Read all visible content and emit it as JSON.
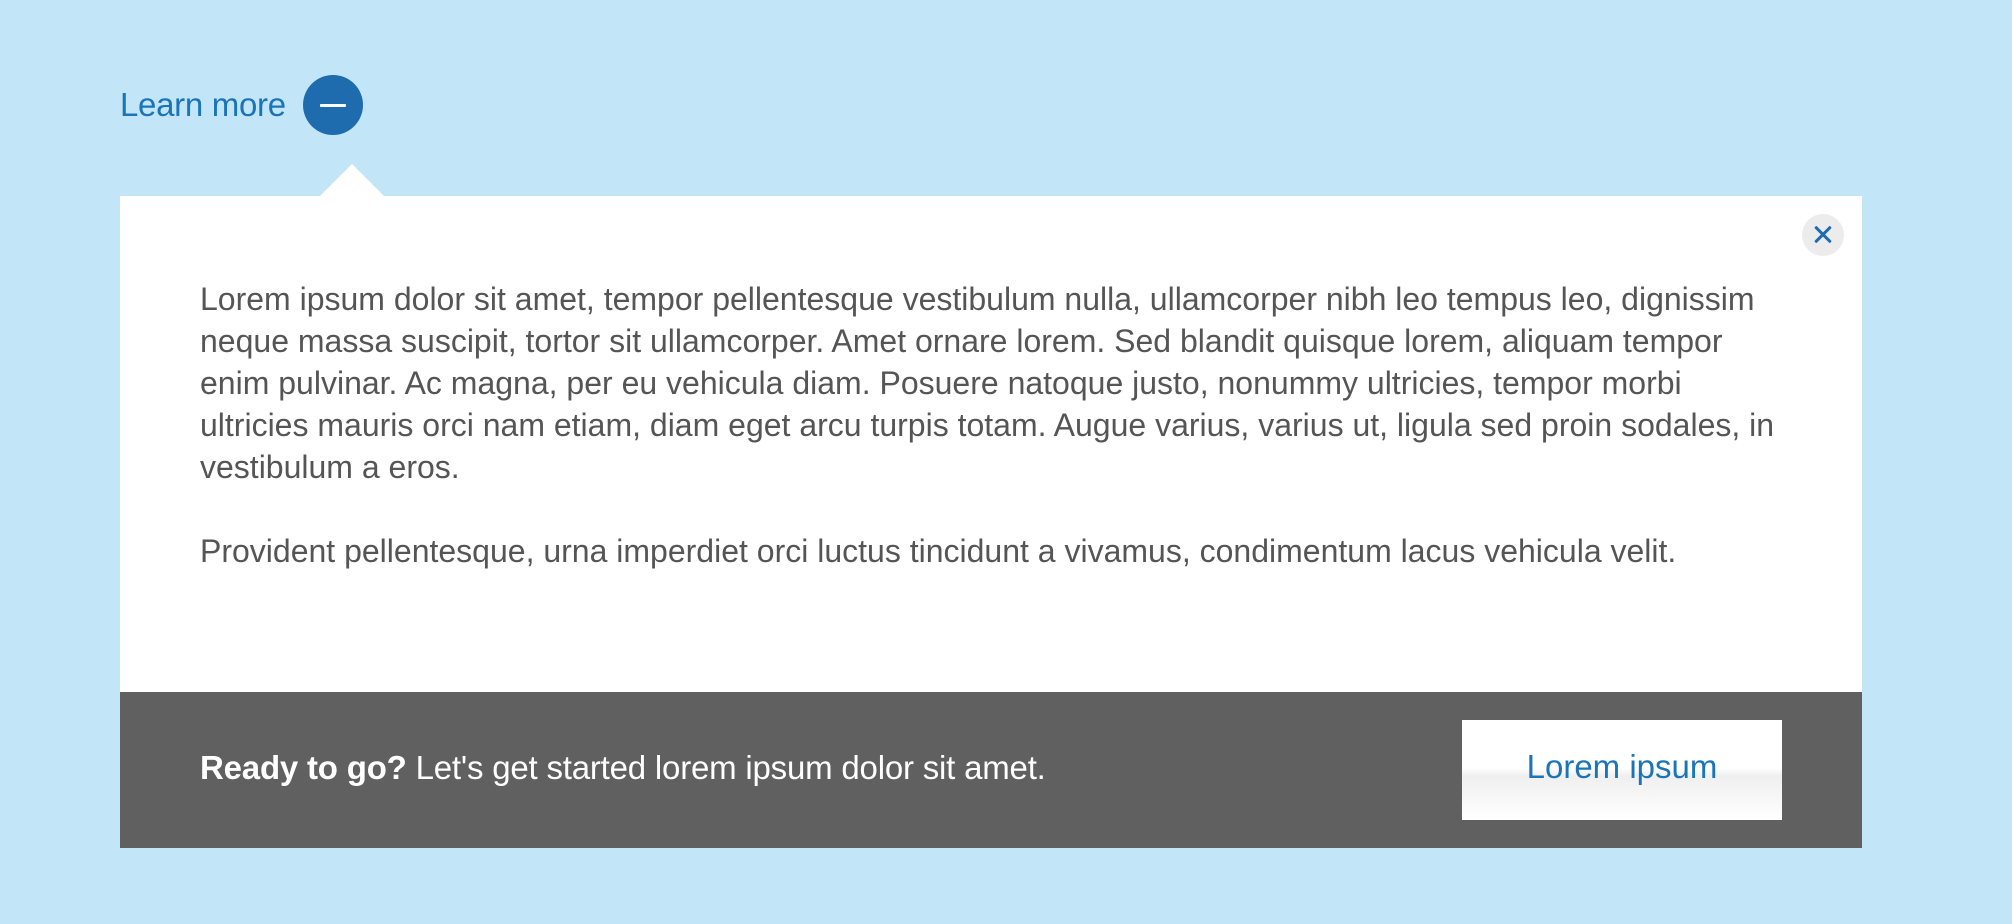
{
  "toggle": {
    "label": "Learn more",
    "state_icon": "minus-icon"
  },
  "panel": {
    "close_icon": "close-icon",
    "paragraphs": [
      "Lorem ipsum dolor sit amet, tempor pellentesque vestibulum nulla, ullamcorper nibh leo tempus leo, dignissim neque massa suscipit, tortor sit ullamcorper. Amet ornare lorem. Sed blandit quisque lorem, aliquam tempor enim pulvinar. Ac magna, per eu vehicula diam. Posuere natoque justo, nonummy ultricies, tempor morbi ultricies mauris orci nam etiam, diam eget arcu turpis totam. Augue varius, varius ut, ligula sed proin sodales, in vestibulum a eros.",
      "Provident pellentesque, urna imperdiet orci luctus tincidunt a vivamus, condimentum lacus vehicula velit."
    ]
  },
  "cta": {
    "lead": "Ready to go?",
    "text": " Let's get started lorem ipsum dolor sit amet.",
    "button_label": "Lorem ipsum"
  },
  "colors": {
    "background": "#c2e6f7",
    "accent": "#1e6bae",
    "link": "#1a74b9",
    "cta_bar": "#606060",
    "body_text": "#555555"
  }
}
